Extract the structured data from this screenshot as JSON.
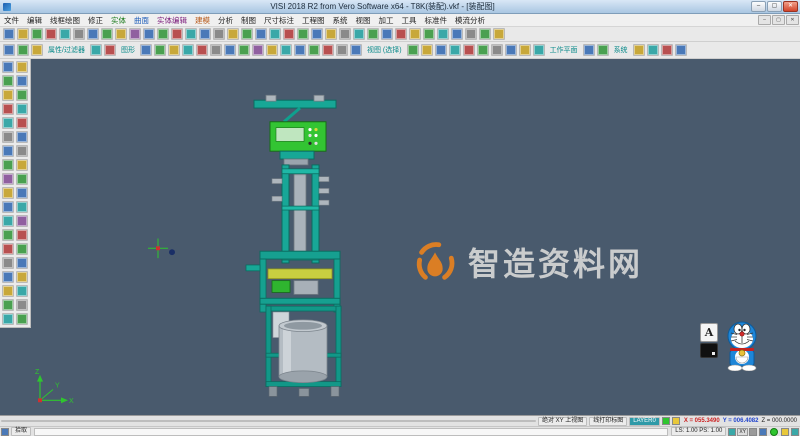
{
  "window": {
    "title": "VISI 2018 R2 from Vero Software x64 - T8K(装配).vkf - [装配图]",
    "min_label": "–",
    "max_label": "▢",
    "close_label": "✕"
  },
  "menu": {
    "items": [
      {
        "label": "文件"
      },
      {
        "label": "编辑"
      },
      {
        "label": "线框绘图"
      },
      {
        "label": "修正"
      },
      {
        "label": "实体",
        "color": "#1a7a1a"
      },
      {
        "label": "曲面",
        "color": "#1a5ab8"
      },
      {
        "label": "实体编辑",
        "color": "#7a1a7a"
      },
      {
        "label": "建模",
        "color": "#b85a1a"
      },
      {
        "label": "分析"
      },
      {
        "label": "制图"
      },
      {
        "label": "尺寸标注"
      },
      {
        "label": "工程图"
      },
      {
        "label": "系统"
      },
      {
        "label": "视图"
      },
      {
        "label": "加工"
      },
      {
        "label": "工具"
      },
      {
        "label": "标准件"
      },
      {
        "label": "模流分析"
      }
    ]
  },
  "toolbar_row1": {
    "icons": [
      "#4a79b8",
      "#c8a83a",
      "#4aa050",
      "#b85050",
      "#3aa8a8",
      "#8a8a8a",
      "#4a79b8",
      "#4aa050",
      "#c8a83a",
      "#9060a0",
      "#4a79b8",
      "#4aa050",
      "#b85050",
      "#3aa8a8",
      "#4a79b8",
      "#8a8a8a",
      "#c8a83a",
      "#4aa050",
      "#4a79b8",
      "#3aa8a8",
      "#b85050",
      "#4aa050",
      "#4a79b8",
      "#c8a83a",
      "#8a8a8a",
      "#3aa8a8",
      "#4aa050",
      "#4a79b8",
      "#b85050",
      "#c8a83a",
      "#4aa050",
      "#3aa8a8",
      "#4a79b8",
      "#8a8a8a",
      "#4aa050",
      "#c8a83a"
    ]
  },
  "toolbar_row2": {
    "groups": [
      {
        "label": "属性/过滤器",
        "icons": [
          "#4a79b8",
          "#4aa050",
          "#c8a83a"
        ]
      },
      {
        "label": "图形",
        "icons": [
          "#3aa8a8",
          "#b85050"
        ]
      },
      {
        "label": "视图 (选择)",
        "icons": [
          "#4a79b8",
          "#4aa050",
          "#c8a83a",
          "#3aa8a8",
          "#b85050",
          "#8a8a8a",
          "#4a79b8",
          "#4aa050",
          "#9060a0",
          "#c8a83a",
          "#3aa8a8",
          "#4a79b8",
          "#4aa050",
          "#b85050",
          "#8a8a8a",
          "#4a79b8"
        ]
      },
      {
        "label": "工作平面",
        "icons": [
          "#4aa050",
          "#c8a83a",
          "#4a79b8",
          "#3aa8a8",
          "#b85050",
          "#4aa050",
          "#8a8a8a",
          "#4a79b8",
          "#c8a83a",
          "#3aa8a8"
        ]
      },
      {
        "label": "系统",
        "icons": [
          "#4a79b8",
          "#4aa050"
        ]
      },
      {
        "label": "",
        "icons": [
          "#c8a83a",
          "#3aa8a8",
          "#b85050",
          "#4a79b8"
        ]
      }
    ]
  },
  "left_toolbar": {
    "col1": [
      "#4a79b8",
      "#4aa050",
      "#c8a83a",
      "#b85050",
      "#3aa8a8",
      "#8a8a8a",
      "#4a79b8",
      "#4aa050",
      "#9060a0",
      "#c8a83a",
      "#4a79b8",
      "#3aa8a8",
      "#4aa050",
      "#b85050",
      "#8a8a8a",
      "#4a79b8",
      "#c8a83a",
      "#4aa050",
      "#3aa8a8"
    ],
    "col2": [
      "#c8a83a",
      "#4a79b8",
      "#4aa050",
      "#3aa8a8",
      "#b85050",
      "#4a79b8",
      "#8a8a8a",
      "#c8a83a",
      "#4aa050",
      "#4a79b8",
      "#3aa8a8",
      "#9060a0",
      "#b85050",
      "#4aa050",
      "#4a79b8",
      "#c8a83a",
      "#3aa8a8",
      "#8a8a8a",
      "#4aa050"
    ]
  },
  "watermark": {
    "text": "智造资料网",
    "text_color": "#d6d6d6",
    "logo_color": "#e8821e"
  },
  "overlay_panel": {
    "letter": "A"
  },
  "statusbar": {
    "row1": {
      "workplane": "绝对 XY 上视图",
      "view": "线打印标图",
      "layer": "LAYER0",
      "coords": {
        "x": "X = 055.3490",
        "y": "Y = 006.4082",
        "z": "Z = 000.0000"
      }
    },
    "row2": {
      "left_label": "拾取",
      "scale": "LS: 1.00 PS: 1.00",
      "xy_label": "XY"
    }
  },
  "colors": {
    "viewport_bg": "#495a6d",
    "model_teal": "#17a796",
    "model_green": "#33c433",
    "model_yellow": "#c9cf40",
    "coord_x": "#cc2222",
    "coord_y": "#2244cc",
    "layer_badge": "#2f9aa8"
  }
}
